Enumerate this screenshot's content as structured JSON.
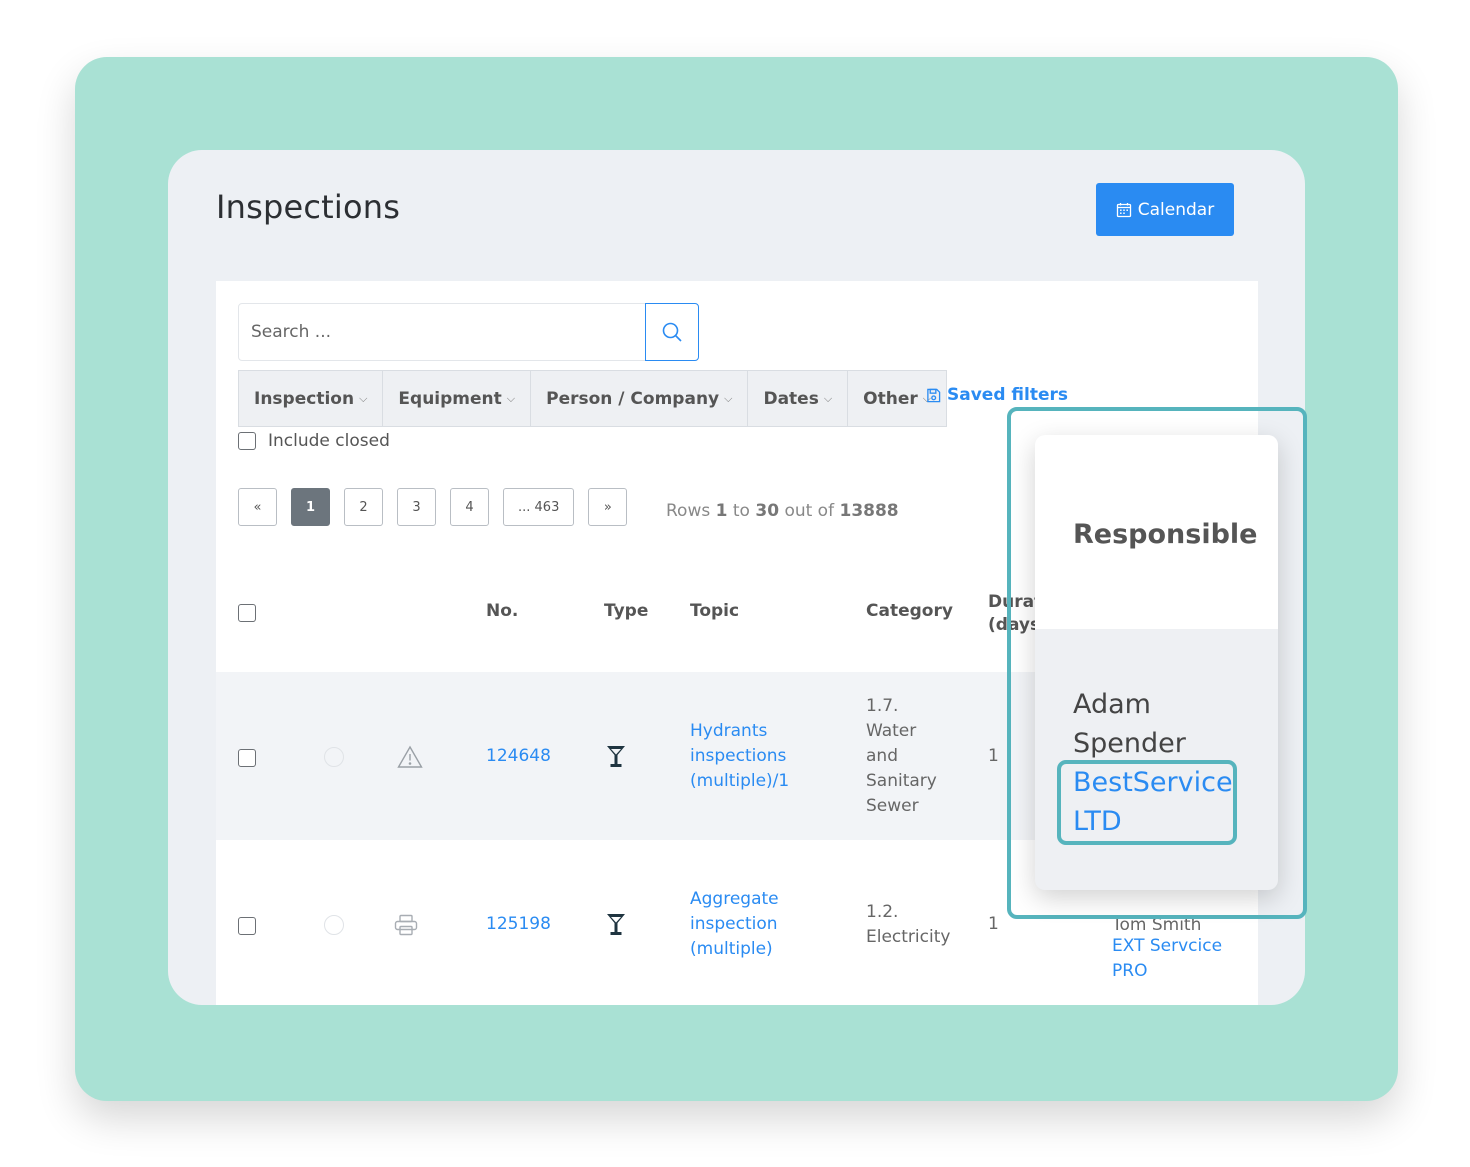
{
  "page": {
    "title": "Inspections"
  },
  "header": {
    "calendar_label": "Calendar"
  },
  "search": {
    "placeholder": "Search ..."
  },
  "filters": [
    {
      "label": "Inspection"
    },
    {
      "label": "Equipment"
    },
    {
      "label": "Person / Company"
    },
    {
      "label": "Dates"
    },
    {
      "label": "Other"
    }
  ],
  "saved_filters_label": "Saved filters",
  "include_closed_label": "Include closed",
  "pagination": {
    "prev": "«",
    "pages": [
      "1",
      "2",
      "3",
      "4",
      "... 463"
    ],
    "next": "»",
    "active": "1"
  },
  "rows_info": {
    "prefix": "Rows",
    "from": "1",
    "to_word": "to",
    "to": "30",
    "out_of": "out of",
    "total": "13888"
  },
  "table": {
    "headers": {
      "no": "No.",
      "type": "Type",
      "topic": "Topic",
      "category": "Category",
      "duration": "Durat (days"
    },
    "rows": [
      {
        "no": "124648",
        "topic": "Hydrants inspections (multiple)/1",
        "category": "1.7. Water and Sanitary Sewer",
        "duration": "1",
        "status_icon": "warning-icon",
        "type_icon": "cocktail-icon"
      },
      {
        "no": "125198",
        "topic": "Aggregate inspection (multiple)",
        "category": "1.2. Electricity",
        "duration": "1",
        "responsible_name": "Tom Smith",
        "responsible_company": "EXT Servcice PRO",
        "status_icon": "printer-icon",
        "type_icon": "cocktail-icon"
      }
    ]
  },
  "popup": {
    "title": "Responsible",
    "name": "Adam Spender",
    "company": "BestService LTD"
  },
  "colors": {
    "accent": "#2a8bf2",
    "background": "#a9e1d4",
    "highlight": "#56b4bd"
  }
}
